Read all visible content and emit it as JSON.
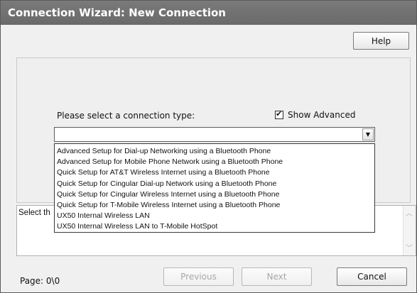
{
  "window": {
    "title": "Connection Wizard: New Connection"
  },
  "toolbar": {
    "help_label": "Help"
  },
  "form": {
    "prompt": "Please select a connection type:",
    "show_advanced_label": "Show Advanced",
    "show_advanced_checked": true,
    "combo_value": "",
    "options": [
      "Advanced Setup for Dial-up Networking using a Bluetooth Phone",
      "Advanced Setup for Mobile Phone Network using a Bluetooth Phone",
      "Quick Setup for AT&T Wireless Internet using a Bluetooth Phone",
      "Quick Setup for Cingular Dial-up Network using a Bluetooth Phone",
      "Quick Setup for Cingular Wireless Internet using a Bluetooth Phone",
      "Quick Setup for T-Mobile Wireless Internet using a Bluetooth Phone",
      "UX50 Internal Wireless LAN",
      "UX50 Internal Wireless LAN to T-Mobile HotSpot"
    ]
  },
  "description": {
    "text": "Select th"
  },
  "footer": {
    "page_label": "Page:  0\\0",
    "previous_label": "Previous",
    "next_label": "Next",
    "cancel_label": "Cancel"
  },
  "icons": {
    "checkbox": "checkmark-icon",
    "combo": "chevron-down-icon",
    "scroll_up": "chevron-up-icon",
    "scroll_down": "chevron-down-icon"
  }
}
